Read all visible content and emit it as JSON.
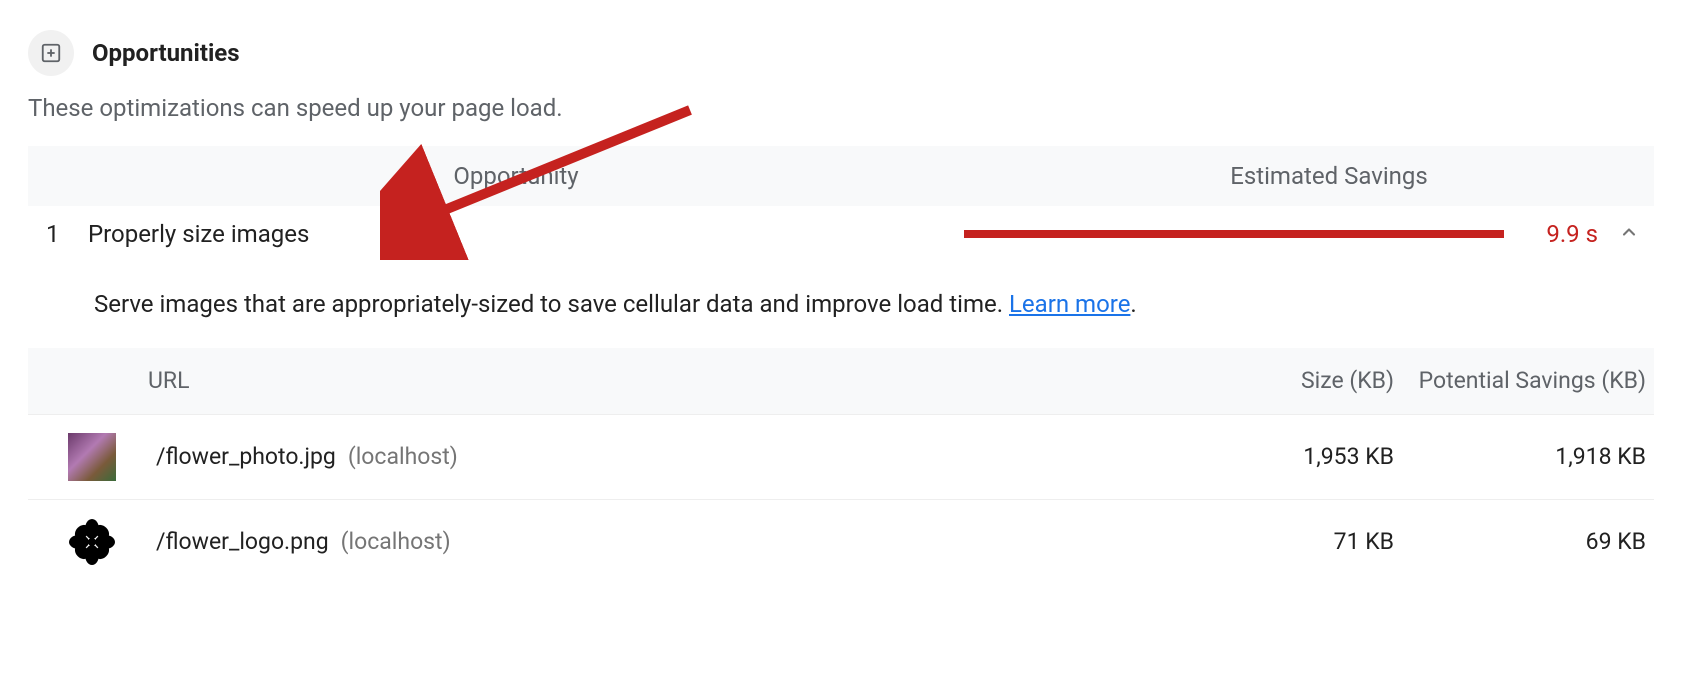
{
  "section": {
    "title": "Opportunities",
    "description": "These optimizations can speed up your page load."
  },
  "columns": {
    "opportunity": "Opportunity",
    "savings": "Estimated Savings"
  },
  "opportunity_row": {
    "index": "1",
    "name": "Properly size images",
    "savings_value": "9.9 s"
  },
  "detail": {
    "text_before_link": "Serve images that are appropriately-sized to save cellular data and improve load time. ",
    "link_text": "Learn more",
    "text_after_link": "."
  },
  "table": {
    "headers": {
      "url": "URL",
      "size": "Size (KB)",
      "potential": "Potential Savings (KB)"
    },
    "rows": [
      {
        "thumb": "photo",
        "path": "/flower_photo.jpg",
        "host": "(localhost)",
        "size": "1,953 KB",
        "potential": "1,918 KB"
      },
      {
        "thumb": "logo",
        "path": "/flower_logo.png",
        "host": "(localhost)",
        "size": "71 KB",
        "potential": "69 KB"
      }
    ]
  }
}
